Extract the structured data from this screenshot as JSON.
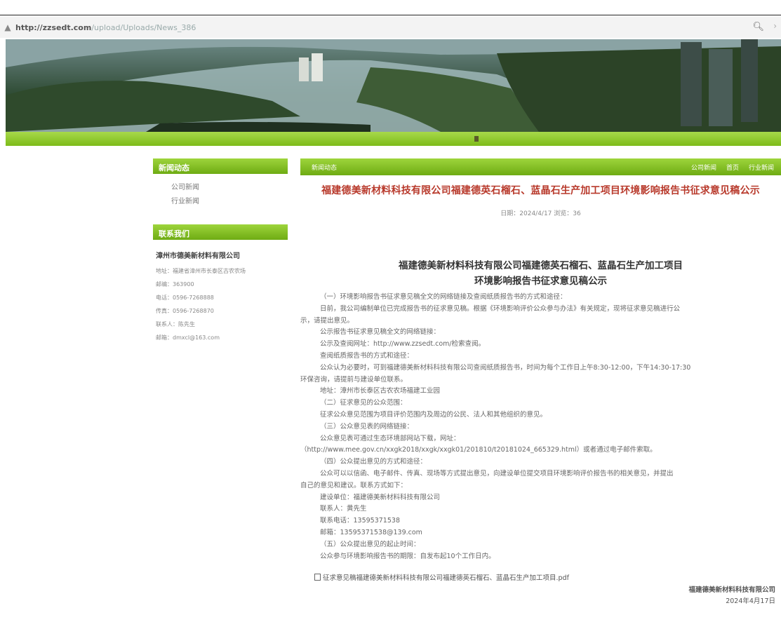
{
  "browser": {
    "url_host": "http://zzsedt.com",
    "url_path": "/upload/Uploads/News_386",
    "zoom_icon": "magnifier-icon",
    "more_icon": "chevron-icon"
  },
  "banner": {
    "image": "river-city-panorama"
  },
  "sidebar": {
    "news_header": "新闻动态",
    "news_items": [
      "公司新闻",
      "行业新闻"
    ],
    "contact_header": "联系我们",
    "contact_company": "漳州市德美新材料有限公司",
    "contact_rows": [
      "地址：福建省漳州市长泰区古农农场",
      "邮编：363900",
      "电话：0596-7268888",
      "传真：0596-7268870",
      "联系人：陈先生",
      "邮箱：dmxcl@163.com"
    ]
  },
  "main": {
    "bar_left": "新闻动态",
    "bar_links": [
      "公司新闻",
      "首页",
      "行业新闻"
    ],
    "article_title": "福建德美新材料科技有限公司福建德英石榴石、蓝晶石生产加工项目环境影响报告书征求意见稿公示",
    "meta": "日期：2024/4/17  浏览：36",
    "doc_title_line1": "福建德美新材料科技有限公司福建德英石榴石、蓝晶石生产加工项目",
    "doc_title_line2": "环境影响报告书征求意见稿公示",
    "paragraphs": [
      {
        "indent": 1,
        "text": "（一）环境影响报告书征求意见稿全文的网络链接及查阅纸质报告书的方式和途径："
      },
      {
        "indent": 1,
        "text": "日前，我公司编制单位已完成报告书的征求意见稿。根据《环境影响评价公众参与办法》有关规定，现将征求意见稿进行公"
      },
      {
        "indent": 0,
        "text": "示，请提出意见。"
      },
      {
        "indent": 1,
        "text": "公示报告书征求意见稿全文的网络链接："
      },
      {
        "indent": 1,
        "text": "公示及查阅网址：http://www.zzsedt.com/检索查阅。"
      },
      {
        "indent": 1,
        "text": "查阅纸质报告书的方式和途径："
      },
      {
        "indent": 1,
        "text": "公众认为必要时，可到福建德美新材料科技有限公司查阅纸质报告书，时间为每个工作日上午8:30-12:00，下午14:30-17:30"
      },
      {
        "indent": 0,
        "text": "环保咨询，请提前与建设单位联系。"
      },
      {
        "indent": 1,
        "text": "地址：漳州市长泰区古农农场福建工业园"
      },
      {
        "indent": 1,
        "text": "（二）征求意见的公众范围："
      },
      {
        "indent": 1,
        "text": "征求公众意见范围为项目评价范围内及周边的公民、法人和其他组织的意见。"
      },
      {
        "indent": 1,
        "text": "（三）公众意见表的网络链接："
      },
      {
        "indent": 1,
        "text": "公众意见表可通过生态环境部网站下载，网址："
      },
      {
        "indent": 0,
        "text": "（http://www.mee.gov.cn/xxgk2018/xxgk/xxgk01/201810/t20181024_665329.html）或者通过电子邮件索取。"
      },
      {
        "indent": 1,
        "text": "（四）公众提出意见的方式和途径："
      },
      {
        "indent": 1,
        "text": "公众可以以信函、电子邮件、传真、现场等方式提出意见，向建设单位提交项目环境影响评价报告书的相关意见，并提出"
      },
      {
        "indent": 0,
        "text": "自己的意见和建议。联系方式如下："
      },
      {
        "indent": 1,
        "text": "建设单位：福建德美新材料科技有限公司"
      },
      {
        "indent": 1,
        "text": "联系人：黄先生"
      },
      {
        "indent": 1,
        "text": "联系电话：13595371538"
      },
      {
        "indent": 1,
        "text": "邮箱：13595371538@139.com"
      },
      {
        "indent": 1,
        "text": "（五）公众提出意见的起止时间："
      },
      {
        "indent": 1,
        "text": "公众参与环境影响报告书的期限：自发布起10个工作日内。"
      }
    ],
    "attachment": "征求意见稿福建德美新材料科技有限公司福建德英石榴石、蓝晶石生产加工项目.pdf",
    "sign_company": "福建德美新材料科技有限公司",
    "sign_date": "2024年4月17日"
  }
}
